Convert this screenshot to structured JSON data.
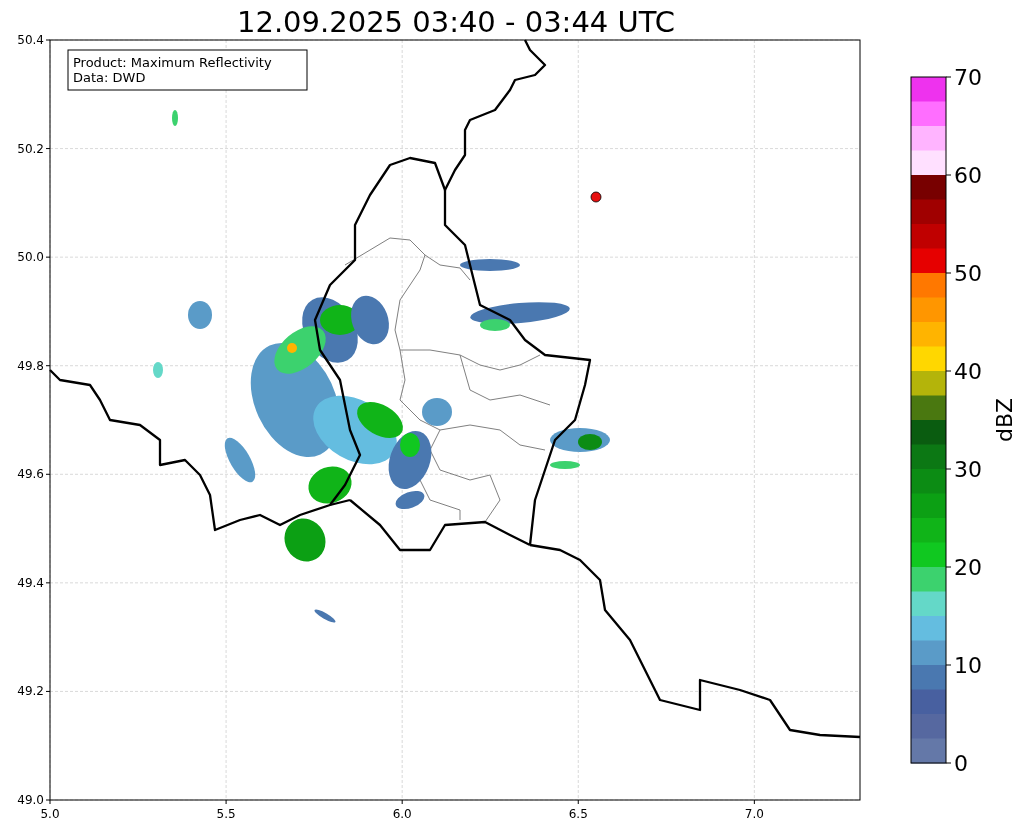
{
  "title": "12.09.2025 03:40 - 03:44 UTC",
  "info_box": [
    "Product: Maximum Reflectivity",
    "Data: DWD"
  ],
  "x_axis": {
    "ticks": [
      "5.0",
      "5.5",
      "6.0",
      "6.5",
      "7.0"
    ]
  },
  "y_axis": {
    "ticks": [
      "50.4",
      "50.2",
      "50.0",
      "49.8",
      "49.6",
      "49.4",
      "49.2",
      "49.0"
    ]
  },
  "colorbar": {
    "label": "dBZ",
    "ticks": [
      "70",
      "60",
      "50",
      "40",
      "30",
      "20",
      "10",
      "0"
    ],
    "bins": [
      {
        "color": "#ee32ee"
      },
      {
        "color": "#ff6eff"
      },
      {
        "color": "#ffb4ff"
      },
      {
        "color": "#ffe0ff"
      },
      {
        "color": "#780000"
      },
      {
        "color": "#a00000"
      },
      {
        "color": "#c00000"
      },
      {
        "color": "#e60000"
      },
      {
        "color": "#ff7800"
      },
      {
        "color": "#ff9600"
      },
      {
        "color": "#ffb400"
      },
      {
        "color": "#ffd700"
      },
      {
        "color": "#b4b40a"
      },
      {
        "color": "#4a7810"
      },
      {
        "color": "#0a5c10"
      },
      {
        "color": "#0c7814"
      },
      {
        "color": "#0c8c14"
      },
      {
        "color": "#0ca014"
      },
      {
        "color": "#10b418"
      },
      {
        "color": "#10c820"
      },
      {
        "color": "#3cd26e"
      },
      {
        "color": "#64d8c8"
      },
      {
        "color": "#64bde0"
      },
      {
        "color": "#5a9bc8"
      },
      {
        "color": "#4a78b0"
      },
      {
        "color": "#4860a0"
      },
      {
        "color": "#5668a0"
      },
      {
        "color": "#6478a8"
      }
    ]
  }
}
